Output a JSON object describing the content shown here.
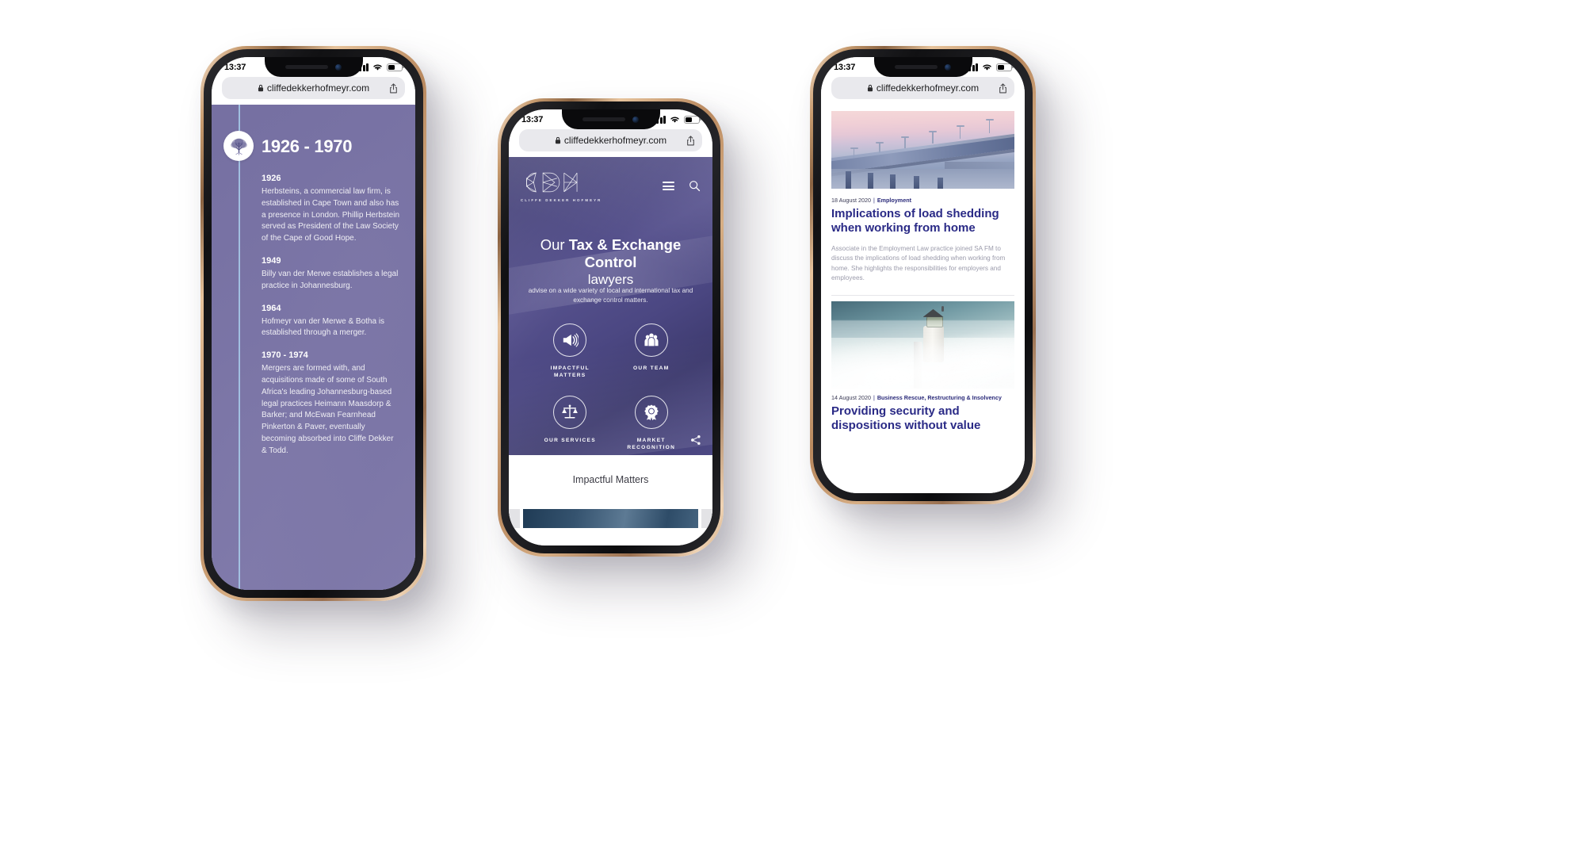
{
  "browser": {
    "status": {
      "time": "13:37",
      "signal_icon": "cellular-bars-icon",
      "wifi_icon": "wifi-icon",
      "battery_icon": "battery-icon"
    },
    "url": "cliffedekkerhofmeyr.com",
    "lock_icon": "lock-icon",
    "share_icon": "share-ios-icon"
  },
  "phone_left": {
    "name": "timeline-screen",
    "page_title": "1926 - 1970",
    "node_icon": "tree-logo-icon",
    "events": [
      {
        "year": "1926",
        "text": "Herbsteins, a commercial law firm, is established in Cape Town and also has a presence in London. Phillip Herbstein served as President of the Law Society of the Cape of Good Hope."
      },
      {
        "year": "1949",
        "text": "Billy van der Merwe establishes a legal practice in Johannesburg."
      },
      {
        "year": "1964",
        "text": "Hofmeyr van der Merwe & Botha is established through a merger."
      },
      {
        "year": "1970 - 1974",
        "text": "Mergers are formed with, and acquisitions made of some of South Africa's leading Johannesburg-based legal practices Heimann Maasdorp & Barker; and McEwan Fearnhead Pinkerton & Paver, eventually becoming absorbed into Cliffe Dekker & Todd."
      }
    ],
    "colors": {
      "background": "#7b76a9",
      "timeline_line": "#a8cdeb",
      "node_fill": "#ffffff"
    }
  },
  "phone_center": {
    "name": "cdh-home-screen",
    "logo": {
      "mark": "CDH",
      "wordmark": "CLIFFE DEKKER HOFMEYR",
      "icon": "cdh-wireframe-logo-icon"
    },
    "nav": {
      "menu_icon": "hamburger-menu-icon",
      "search_icon": "search-icon"
    },
    "hero": {
      "title_lead": "Our ",
      "title_strong": "Tax & Exchange Control",
      "title_line2": "lawyers",
      "subtitle": "advise on a wide variety of local and international tax and exchange control matters."
    },
    "quick_links": [
      {
        "label": "IMPACTFUL MATTERS",
        "icon": "megaphone-icon"
      },
      {
        "label": "OUR TEAM",
        "icon": "people-group-icon"
      },
      {
        "label": "OUR SERVICES",
        "icon": "scales-of-justice-icon"
      },
      {
        "label": "MARKET RECOGNITION",
        "icon": "award-ribbon-icon"
      }
    ],
    "share_icon": "share-network-icon",
    "section_title": "Impactful Matters",
    "colors": {
      "hero_background": "#4a4680",
      "accent": "#ffffff"
    }
  },
  "phone_right": {
    "name": "news-feed-screen",
    "articles": [
      {
        "image": "bridge-at-dusk-photo",
        "date": "18 August 2020",
        "separator": "|",
        "category": "Employment",
        "headline": "Implications of load shedding when working from home",
        "excerpt": "Associate in the Employment Law practice joined SA FM to discuss the implications of load shedding when working from home. She highlights the responsibilities for employers and employees."
      },
      {
        "image": "lighthouse-in-storm-photo",
        "date": "14 August 2020",
        "separator": "|",
        "category": "Business Rescue, Restructuring & Insolvency",
        "headline": "Providing security and dispositions without value",
        "excerpt": ""
      }
    ],
    "colors": {
      "headline": "#2a2a86",
      "category": "#2b2b7a",
      "excerpt": "#9b9bab"
    }
  }
}
